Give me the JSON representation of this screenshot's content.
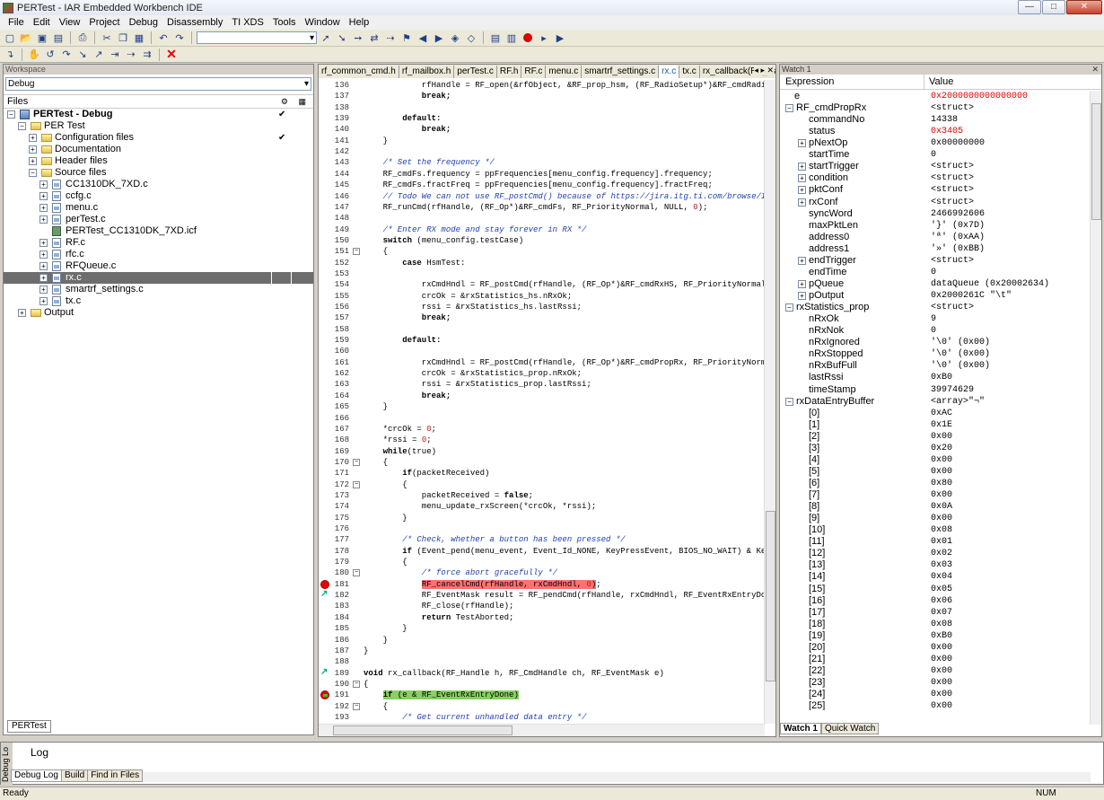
{
  "window": {
    "title": "PERTest - IAR Embedded Workbench IDE"
  },
  "menu": [
    "File",
    "Edit",
    "View",
    "Project",
    "Debug",
    "Disassembly",
    "TI XDS",
    "Tools",
    "Window",
    "Help"
  ],
  "workspace": {
    "header": "Workspace",
    "config": "Debug",
    "files_header": "Files",
    "bottom_tab": "PERTest",
    "tree": [
      {
        "label": "PERTest - Debug",
        "bold": true,
        "check": "✔",
        "kind": "proj",
        "exp": "−",
        "indent": 0
      },
      {
        "label": "PER Test",
        "kind": "folder",
        "exp": "−",
        "indent": 1
      },
      {
        "label": "Configuration files",
        "kind": "folder",
        "exp": "+",
        "indent": 2,
        "check": "✔"
      },
      {
        "label": "Documentation",
        "kind": "folder",
        "exp": "+",
        "indent": 2
      },
      {
        "label": "Header files",
        "kind": "folder",
        "exp": "+",
        "indent": 2
      },
      {
        "label": "Source files",
        "kind": "folder",
        "exp": "−",
        "indent": 2
      },
      {
        "label": "CC1310DK_7XD.c",
        "kind": "c",
        "exp": "+",
        "indent": 3
      },
      {
        "label": "ccfg.c",
        "kind": "c",
        "exp": "+",
        "indent": 3
      },
      {
        "label": "menu.c",
        "kind": "c",
        "exp": "+",
        "indent": 3
      },
      {
        "label": "perTest.c",
        "kind": "c",
        "exp": "+",
        "indent": 3
      },
      {
        "label": "PERTest_CC1310DK_7XD.icf",
        "kind": "icf",
        "indent": 3
      },
      {
        "label": "RF.c",
        "kind": "c",
        "exp": "+",
        "indent": 3
      },
      {
        "label": "rfc.c",
        "kind": "c",
        "exp": "+",
        "indent": 3
      },
      {
        "label": "RFQueue.c",
        "kind": "c",
        "exp": "+",
        "indent": 3
      },
      {
        "label": "rx.c",
        "kind": "c",
        "exp": "+",
        "indent": 3,
        "selected": true
      },
      {
        "label": "smartrf_settings.c",
        "kind": "c",
        "exp": "+",
        "indent": 3
      },
      {
        "label": "tx.c",
        "kind": "c",
        "exp": "+",
        "indent": 3
      },
      {
        "label": "Output",
        "kind": "folder",
        "exp": "+",
        "indent": 1
      }
    ]
  },
  "editor": {
    "tabs": [
      "rf_common_cmd.h",
      "rf_mailbox.h",
      "perTest.c",
      "RF.h",
      "RF.c",
      "menu.c",
      "smartrf_settings.c",
      "rx.c",
      "tx.c",
      "rx_callback(RF_Handle, RF_ ▾"
    ],
    "active_tab": "rx.c",
    "first_line": 136,
    "lines": [
      [
        [
          "",
          "            rfHandle = RF_open(&rfObject, &RF_prop_hsm, (RF_RadioSetup*)&RF_cmdRadioS"
        ]
      ],
      [
        [
          "kw",
          "            break;"
        ]
      ],
      [
        [
          "",
          ""
        ]
      ],
      [
        [
          "kw",
          "        default:"
        ]
      ],
      [
        [
          "kw",
          "            break;"
        ]
      ],
      [
        [
          "",
          "    }"
        ]
      ],
      [
        [
          "",
          ""
        ]
      ],
      [
        [
          "cm",
          "    /* Set the frequency */"
        ]
      ],
      [
        [
          "",
          "    RF_cmdFs.frequency = ppFrequencies[menu_config.frequency].frequency;"
        ]
      ],
      [
        [
          "",
          "    RF_cmdFs.fractFreq = ppFrequencies[menu_config.frequency].fractFreq;"
        ]
      ],
      [
        [
          "cm",
          "    // Todo We can not use RF_postCmd() because of https://jira.itg.ti.com/browse/I"
        ]
      ],
      [
        [
          "",
          "    RF_runCmd(rfHandle, (RF_Op*)&RF_cmdFs, RF_PriorityNormal, NULL, "
        ],
        [
          "nm",
          "0"
        ],
        [
          "",
          ");"
        ]
      ],
      [
        [
          "",
          ""
        ]
      ],
      [
        [
          "cm",
          "    /* Enter RX mode and stay forever in RX */"
        ]
      ],
      [
        [
          "kw",
          "    switch"
        ],
        [
          "",
          " (menu_config.testCase)"
        ]
      ],
      [
        [
          "",
          "    {"
        ]
      ],
      [
        [
          "kw",
          "        case"
        ],
        [
          "",
          " HsmTest:"
        ]
      ],
      [
        [
          "",
          ""
        ]
      ],
      [
        [
          "",
          "            rxCmdHndl = RF_postCmd(rfHandle, (RF_Op*)&RF_cmdRxHS, RF_PriorityNormal"
        ]
      ],
      [
        [
          "",
          "            crcOk = &rxStatistics_hs.nRxOk;"
        ]
      ],
      [
        [
          "",
          "            rssi = &rxStatistics_hs.lastRssi;"
        ]
      ],
      [
        [
          "kw",
          "            break;"
        ]
      ],
      [
        [
          "",
          ""
        ]
      ],
      [
        [
          "kw",
          "        default:"
        ]
      ],
      [
        [
          "",
          ""
        ]
      ],
      [
        [
          "",
          "            rxCmdHndl = RF_postCmd(rfHandle, (RF_Op*)&RF_cmdPropRx, RF_PriorityNorm"
        ]
      ],
      [
        [
          "",
          "            crcOk = &rxStatistics_prop.nRxOk;"
        ]
      ],
      [
        [
          "",
          "            rssi = &rxStatistics_prop.lastRssi;"
        ]
      ],
      [
        [
          "kw",
          "            break;"
        ]
      ],
      [
        [
          "",
          "    }"
        ]
      ],
      [
        [
          "",
          ""
        ]
      ],
      [
        [
          "",
          "    *crcOk = "
        ],
        [
          "nm",
          "0"
        ],
        [
          "",
          ";"
        ]
      ],
      [
        [
          "",
          "    *rssi = "
        ],
        [
          "nm",
          "0"
        ],
        [
          "",
          ";"
        ]
      ],
      [
        [
          "kw",
          "    while"
        ],
        [
          "",
          "(true)"
        ]
      ],
      [
        [
          "",
          "    {"
        ]
      ],
      [
        [
          "kw",
          "        if"
        ],
        [
          "",
          "(packetReceived)"
        ]
      ],
      [
        [
          "",
          "        {"
        ]
      ],
      [
        [
          "",
          "            packetReceived = "
        ],
        [
          "kw",
          "false"
        ],
        [
          "",
          ";"
        ]
      ],
      [
        [
          "",
          "            menu_update_rxScreen(*crcOk, *rssi);"
        ]
      ],
      [
        [
          "",
          "        }"
        ]
      ],
      [
        [
          "",
          ""
        ]
      ],
      [
        [
          "cm",
          "        /* Check, whether a button has been pressed */"
        ]
      ],
      [
        [
          "kw",
          "        if"
        ],
        [
          "",
          " (Event_pend(menu_event, Event_Id_NONE, KeyPressEvent, BIOS_NO_WAIT) & Ke"
        ]
      ],
      [
        [
          "",
          "        {"
        ]
      ],
      [
        [
          "cm",
          "            /* force abort gracefully */"
        ]
      ],
      [
        [
          "",
          "            "
        ],
        [
          "hlr",
          "RF_cancelCmd(rfHandle, rxCmdHndl, "
        ],
        [
          "hlr nm",
          "0"
        ],
        [
          "hlr",
          ")"
        ],
        [
          "",
          ";"
        ]
      ],
      [
        [
          "",
          "            RF_EventMask result = RF_pendCmd(rfHandle, rxCmdHndl, RF_EventRxEntryDo"
        ]
      ],
      [
        [
          "",
          "            RF_close(rfHandle);"
        ]
      ],
      [
        [
          "kw",
          "            return"
        ],
        [
          "",
          " TestAborted;"
        ]
      ],
      [
        [
          "",
          "        }"
        ]
      ],
      [
        [
          "",
          "    }"
        ]
      ],
      [
        [
          "",
          "}"
        ]
      ],
      [
        [
          "",
          ""
        ]
      ],
      [
        [
          "kw",
          "void"
        ],
        [
          "",
          " rx_callback(RF_Handle h, RF_CmdHandle ch, RF_EventMask e)"
        ]
      ],
      [
        [
          "",
          "{"
        ]
      ],
      [
        [
          "",
          "    "
        ],
        [
          "hlg kw",
          "if"
        ],
        [
          "hlg",
          " (e & RF_EventRxEntryDone)"
        ]
      ],
      [
        [
          "",
          "    {"
        ]
      ],
      [
        [
          "cm",
          "        /* Get current unhandled data entry */"
        ]
      ]
    ],
    "folds": [
      151,
      170,
      172,
      180,
      190,
      192
    ],
    "breakpoints": [
      181
    ],
    "active_bp": [
      191
    ],
    "bookmarks": [
      182,
      189
    ]
  },
  "watch": {
    "header": "Watch 1",
    "col_expression": "Expression",
    "col_value": "Value",
    "rows": [
      {
        "name": "e",
        "value": "0x2000000000000000",
        "red": true,
        "indent": 0
      },
      {
        "name": "RF_cmdPropRx",
        "value": "<struct>",
        "exp": "−",
        "indent": 0
      },
      {
        "name": "commandNo",
        "value": "14338",
        "indent": 1
      },
      {
        "name": "status",
        "value": "0x3405",
        "red": true,
        "indent": 1
      },
      {
        "name": "pNextOp",
        "value": "0x00000000",
        "exp": "+",
        "indent": 1
      },
      {
        "name": "startTime",
        "value": "0",
        "indent": 1
      },
      {
        "name": "startTrigger",
        "value": "<struct>",
        "exp": "+",
        "indent": 1
      },
      {
        "name": "condition",
        "value": "<struct>",
        "exp": "+",
        "indent": 1
      },
      {
        "name": "pktConf",
        "value": "<struct>",
        "exp": "+",
        "indent": 1
      },
      {
        "name": "rxConf",
        "value": "<struct>",
        "exp": "+",
        "indent": 1
      },
      {
        "name": "syncWord",
        "value": "2466992606",
        "indent": 1
      },
      {
        "name": "maxPktLen",
        "value": "'}' (0x7D)",
        "indent": 1
      },
      {
        "name": "address0",
        "value": "'ª' (0xAA)",
        "indent": 1
      },
      {
        "name": "address1",
        "value": "'»' (0xBB)",
        "indent": 1
      },
      {
        "name": "endTrigger",
        "value": "<struct>",
        "exp": "+",
        "indent": 1
      },
      {
        "name": "endTime",
        "value": "0",
        "indent": 1
      },
      {
        "name": "pQueue",
        "value": "dataQueue (0x20002634)",
        "exp": "+",
        "indent": 1
      },
      {
        "name": "pOutput",
        "value": "0x2000261C \"\\t\"",
        "exp": "+",
        "indent": 1
      },
      {
        "name": "rxStatistics_prop",
        "value": "<struct>",
        "exp": "−",
        "indent": 0
      },
      {
        "name": "nRxOk",
        "value": "9",
        "indent": 1
      },
      {
        "name": "nRxNok",
        "value": "0",
        "indent": 1
      },
      {
        "name": "nRxIgnored",
        "value": "'\\0' (0x00)",
        "indent": 1
      },
      {
        "name": "nRxStopped",
        "value": "'\\0' (0x00)",
        "indent": 1
      },
      {
        "name": "nRxBufFull",
        "value": "'\\0' (0x00)",
        "indent": 1
      },
      {
        "name": "lastRssi",
        "value": "0xB0",
        "indent": 1
      },
      {
        "name": "timeStamp",
        "value": "39974629",
        "indent": 1
      },
      {
        "name": "rxDataEntryBuffer",
        "value": "<array>\"¬\"",
        "exp": "−",
        "indent": 0
      },
      {
        "name": "[0]",
        "value": "0xAC",
        "indent": 1
      },
      {
        "name": "[1]",
        "value": "0x1E",
        "indent": 1
      },
      {
        "name": "[2]",
        "value": "0x00",
        "indent": 1
      },
      {
        "name": "[3]",
        "value": "0x20",
        "indent": 1
      },
      {
        "name": "[4]",
        "value": "0x00",
        "indent": 1
      },
      {
        "name": "[5]",
        "value": "0x00",
        "indent": 1
      },
      {
        "name": "[6]",
        "value": "0x80",
        "indent": 1
      },
      {
        "name": "[7]",
        "value": "0x00",
        "indent": 1
      },
      {
        "name": "[8]",
        "value": "0x0A",
        "indent": 1
      },
      {
        "name": "[9]",
        "value": "0x00",
        "indent": 1
      },
      {
        "name": "[10]",
        "value": "0x08",
        "indent": 1
      },
      {
        "name": "[11]",
        "value": "0x01",
        "indent": 1
      },
      {
        "name": "[12]",
        "value": "0x02",
        "indent": 1
      },
      {
        "name": "[13]",
        "value": "0x03",
        "indent": 1
      },
      {
        "name": "[14]",
        "value": "0x04",
        "indent": 1
      },
      {
        "name": "[15]",
        "value": "0x05",
        "indent": 1
      },
      {
        "name": "[16]",
        "value": "0x06",
        "indent": 1
      },
      {
        "name": "[17]",
        "value": "0x07",
        "indent": 1
      },
      {
        "name": "[18]",
        "value": "0x08",
        "indent": 1
      },
      {
        "name": "[19]",
        "value": "0xB0",
        "indent": 1
      },
      {
        "name": "[20]",
        "value": "0x00",
        "indent": 1
      },
      {
        "name": "[21]",
        "value": "0x00",
        "indent": 1
      },
      {
        "name": "[22]",
        "value": "0x00",
        "indent": 1
      },
      {
        "name": "[23]",
        "value": "0x00",
        "indent": 1
      },
      {
        "name": "[24]",
        "value": "0x00",
        "indent": 1
      },
      {
        "name": "[25]",
        "value": "0x00",
        "indent": 1
      }
    ],
    "tabs": [
      "Watch 1",
      "Quick Watch"
    ]
  },
  "log": {
    "title": "Log",
    "side": "Debug Lo",
    "tabs": [
      "Debug Log",
      "Build",
      "Find in Files"
    ]
  },
  "status": {
    "text": "Ready",
    "num": "NUM"
  }
}
